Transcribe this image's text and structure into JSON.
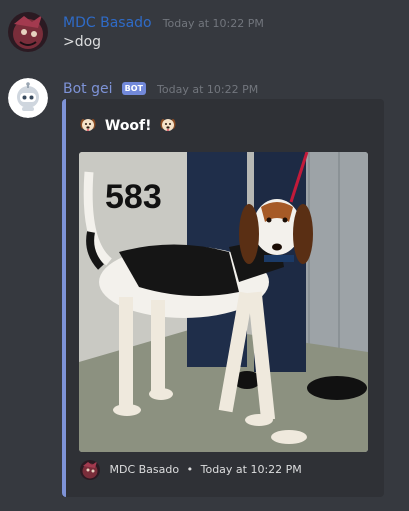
{
  "messages": [
    {
      "author": "MDC Basado",
      "timestamp": "Today at 10:22 PM",
      "text": ">dog",
      "author_color": "#2f6bc7"
    },
    {
      "author": "Bot gei",
      "bot_tag": "BOT",
      "timestamp": "Today at 10:22 PM",
      "author_color": "#7e93d7",
      "embed": {
        "title": "Woof!",
        "image_overlay_number": "583",
        "footer_author": "MDC Basado",
        "footer_separator": "•",
        "footer_timestamp": "Today at 10:22 PM",
        "accent_color": "#7e93d7",
        "icons": [
          "dog-emoji-left",
          "dog-emoji-right",
          "footer-avatar"
        ]
      }
    }
  ]
}
